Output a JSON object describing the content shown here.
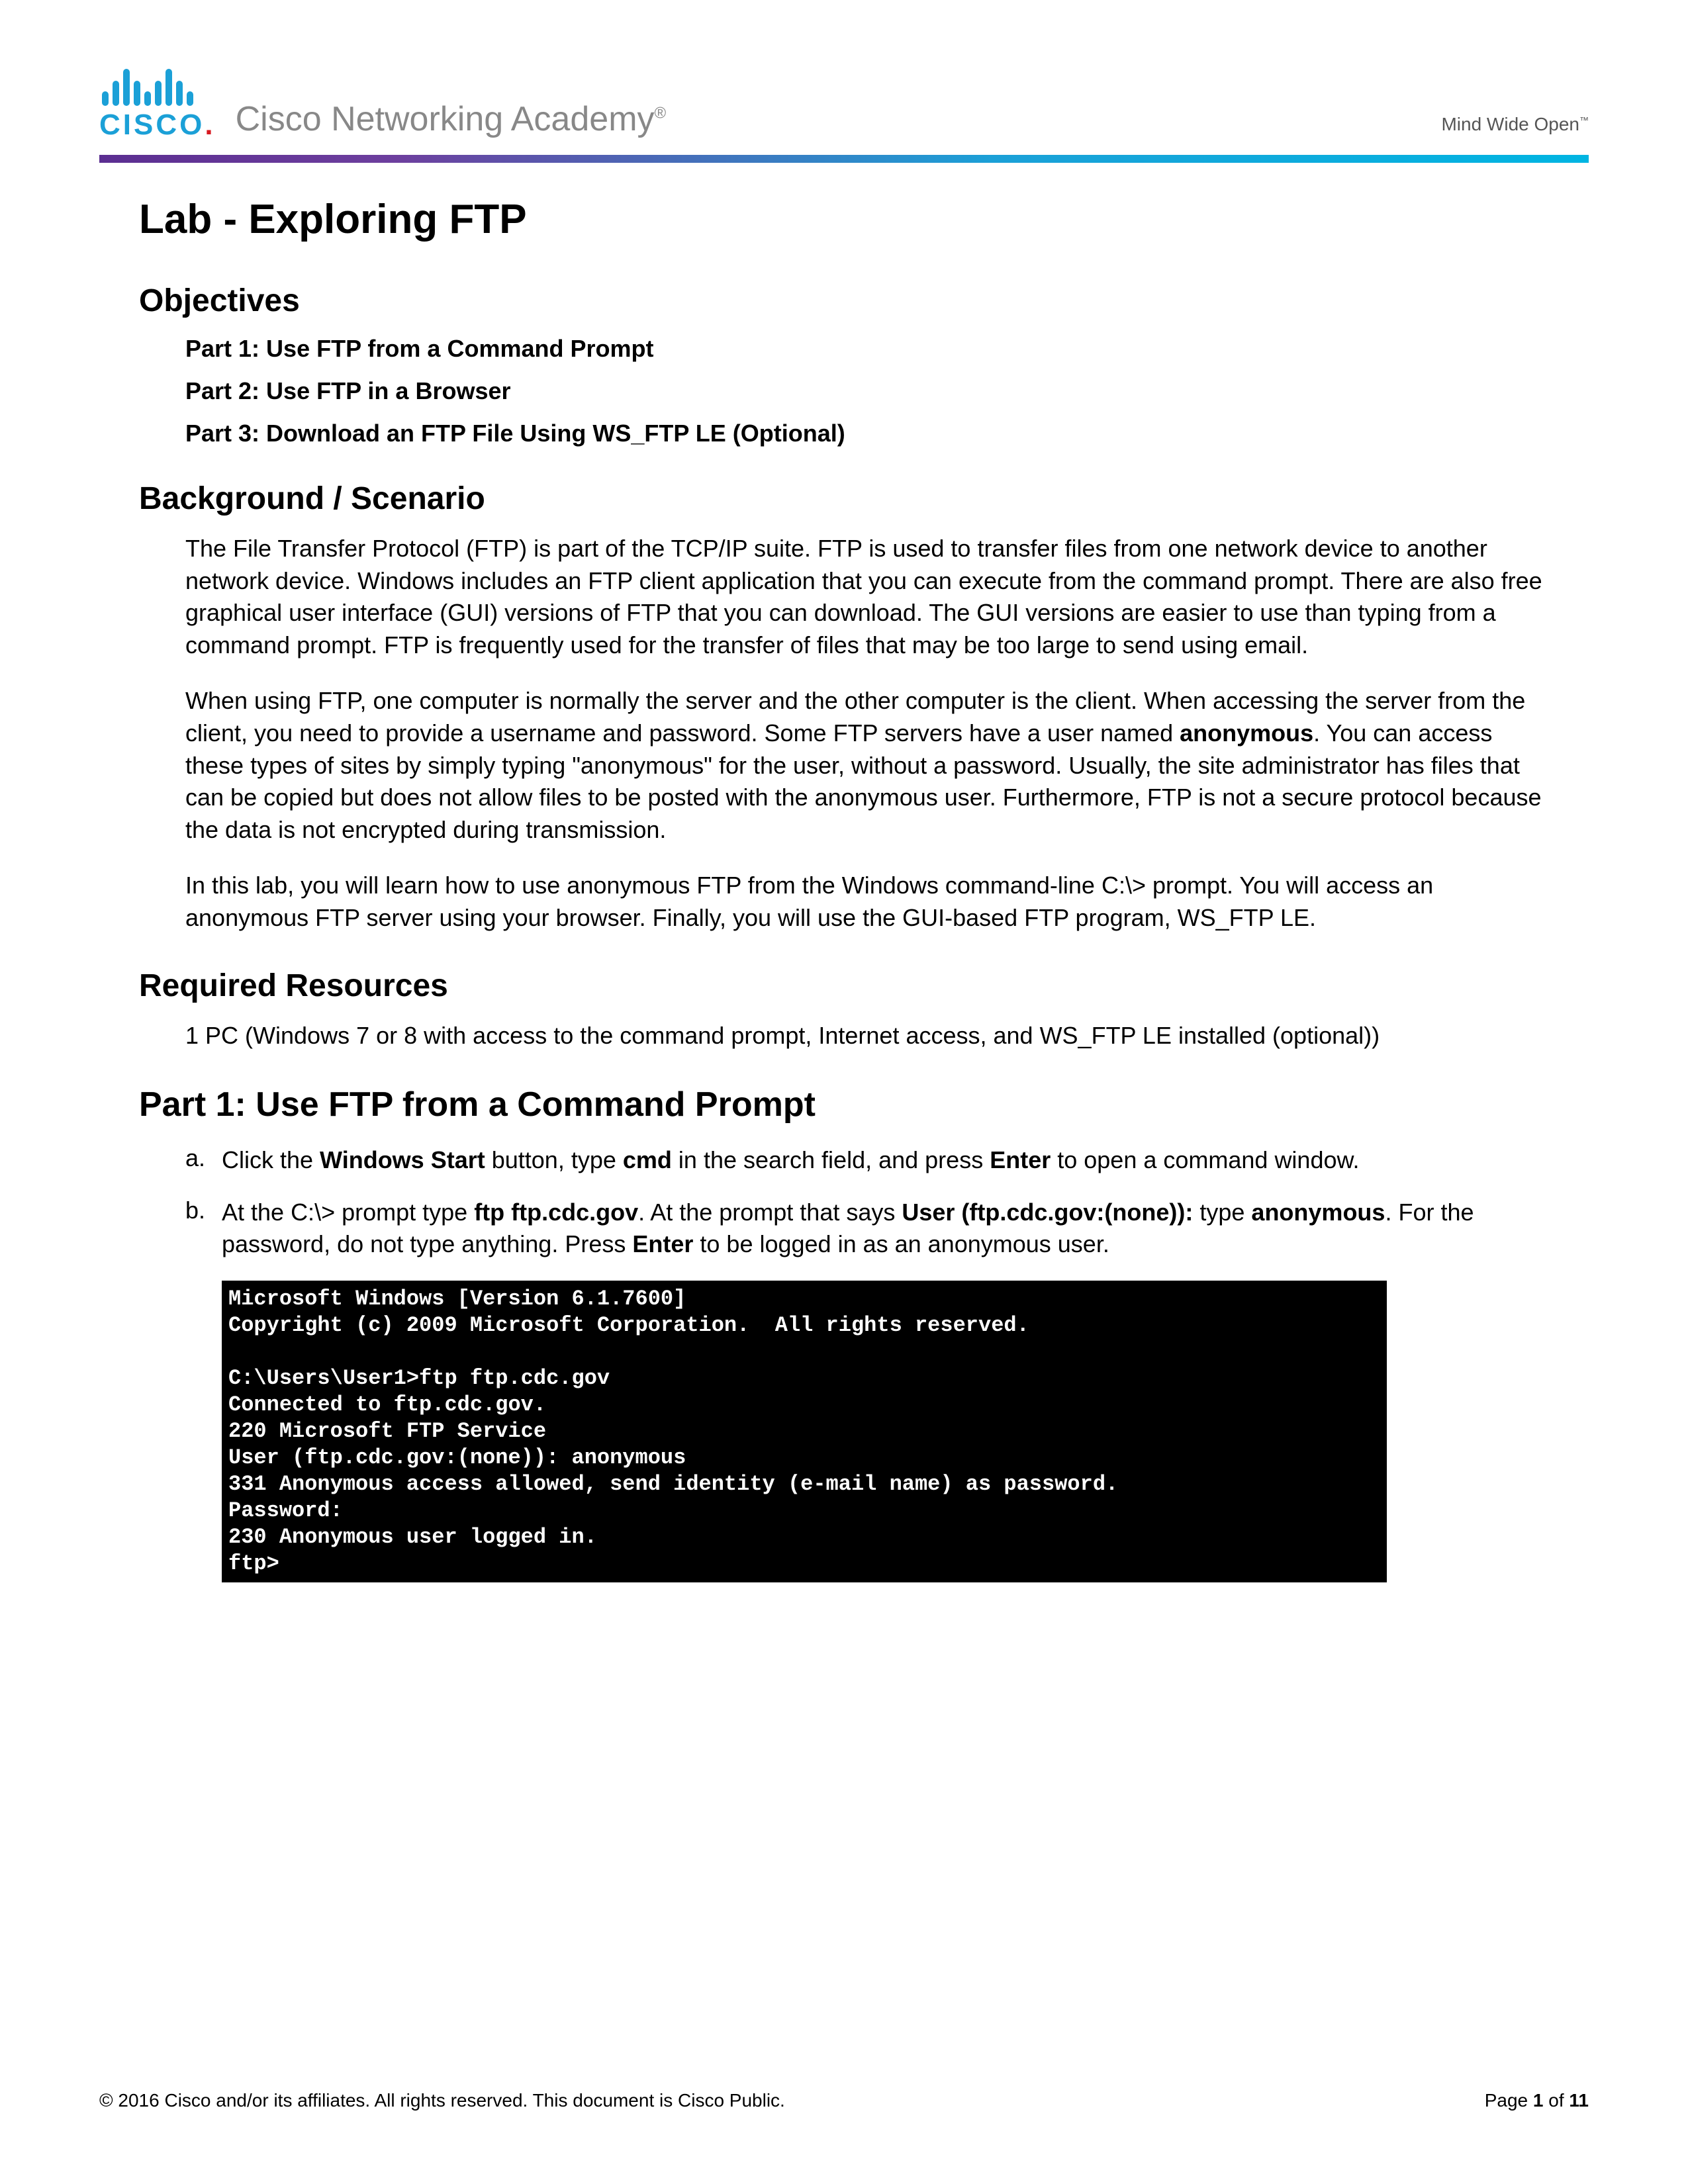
{
  "header": {
    "brand": "CISCO",
    "academy": "Cisco Networking Academy",
    "tagline": "Mind Wide Open"
  },
  "title": "Lab - Exploring FTP",
  "objectives": {
    "heading": "Objectives",
    "items": [
      "Part 1: Use FTP from a Command Prompt",
      "Part 2: Use FTP in a Browser",
      "Part 3: Download an FTP File Using WS_FTP LE (Optional)"
    ]
  },
  "background": {
    "heading": "Background / Scenario",
    "p1": "The File Transfer Protocol (FTP) is part of the TCP/IP suite. FTP is used to transfer files from one network device to another network device. Windows includes an FTP client application that you can execute from the command prompt. There are also free graphical user interface (GUI) versions of FTP that you can download. The GUI versions are easier to use than typing from a command prompt. FTP is frequently used for the transfer of files that may be too large to send using email.",
    "p2_pre": "When using FTP, one computer is normally the server and the other computer is the client. When accessing the server from the client, you need to provide a username and password. Some FTP servers have a user named ",
    "p2_bold": "anonymous",
    "p2_post": ". You can access these types of sites by simply typing \"anonymous\" for the user, without a password. Usually, the site administrator has files that can be copied but does not allow files to be posted with the anonymous user. Furthermore, FTP is not a secure protocol because the data is not encrypted during transmission.",
    "p3": "In this lab, you will learn how to use anonymous FTP from the Windows command-line C:\\> prompt. You will access an anonymous FTP server using your browser. Finally, you will use the GUI-based FTP program, WS_FTP LE."
  },
  "resources": {
    "heading": "Required Resources",
    "text": "1 PC (Windows 7 or 8 with access to the command prompt, Internet access, and WS_FTP LE installed (optional))"
  },
  "part1": {
    "heading": "Part 1:   Use FTP from a Command Prompt",
    "a_marker": "a.",
    "a_pre": "Click the ",
    "a_b1": "Windows Start",
    "a_mid1": " button, type ",
    "a_b2": "cmd",
    "a_mid2": " in the search field, and press ",
    "a_b3": "Enter",
    "a_post": " to open a command window.",
    "b_marker": "b.",
    "b_pre": "At the C:\\> prompt type ",
    "b_b1": "ftp ftp.cdc.gov",
    "b_mid1": ". At the prompt that says ",
    "b_b2": "User (ftp.cdc.gov:(none)):",
    "b_mid2": " type ",
    "b_b3": "anonymous",
    "b_mid3": ". For the password, do not type anything. Press ",
    "b_b4": "Enter",
    "b_post": " to be logged in as an anonymous user."
  },
  "terminal": "Microsoft Windows [Version 6.1.7600]\nCopyright (c) 2009 Microsoft Corporation.  All rights reserved.\n\nC:\\Users\\User1>ftp ftp.cdc.gov\nConnected to ftp.cdc.gov.\n220 Microsoft FTP Service\nUser (ftp.cdc.gov:(none)): anonymous\n331 Anonymous access allowed, send identity (e-mail name) as password.\nPassword:\n230 Anonymous user logged in.\nftp>",
  "footer": {
    "copyright": "© 2016 Cisco and/or its affiliates. All rights reserved. This document is Cisco Public.",
    "page_pre": "Page ",
    "page_cur": "1",
    "page_mid": " of ",
    "page_total": "11"
  }
}
